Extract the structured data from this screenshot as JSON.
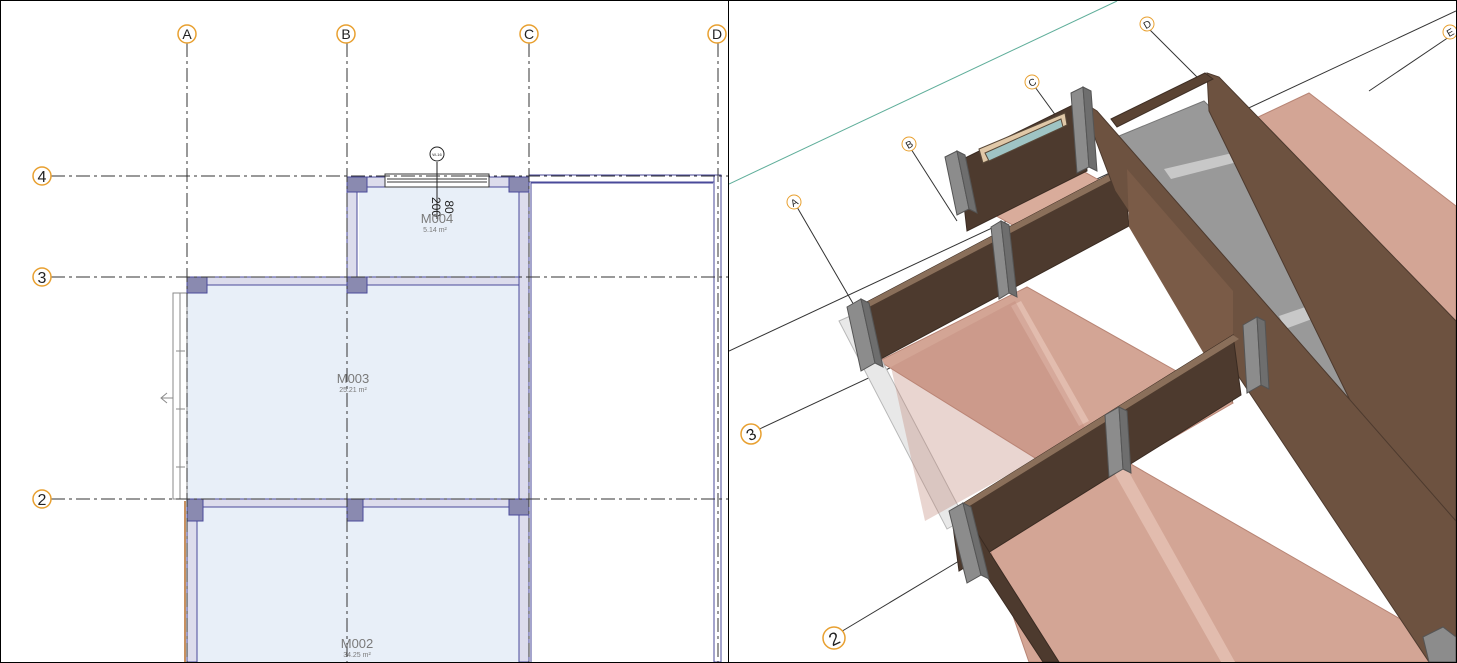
{
  "plan_view": {
    "grid_columns": [
      "A",
      "B",
      "C",
      "D"
    ],
    "grid_rows": [
      "4",
      "3",
      "2"
    ],
    "rooms": [
      {
        "name": "M004",
        "area": "5.14 m²"
      },
      {
        "name": "M003",
        "area": "25.21 m²"
      },
      {
        "name": "M002",
        "area": "34.25 m²"
      }
    ],
    "window_tag": "W-16",
    "window_width": "200",
    "window_height": "80"
  },
  "model_view": {
    "grid_columns": [
      "A",
      "B",
      "C",
      "D",
      "E"
    ],
    "grid_rows": [
      "3",
      "2"
    ]
  },
  "colors": {
    "room_fill": "#e8eff8",
    "wall_outline": "#4a4a9a",
    "column_fill": "#8a8ab0",
    "grid_bubble": "#e8a030",
    "floor_3d": "#d3a595",
    "wall_3d": "#6d5240",
    "slab_3d": "#999999"
  }
}
